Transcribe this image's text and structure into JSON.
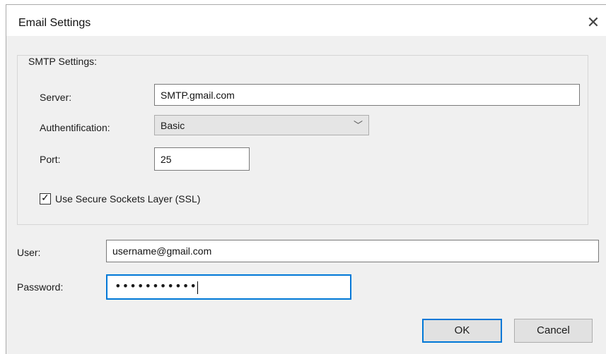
{
  "window": {
    "title": "Email Settings",
    "close_glyph": "✕"
  },
  "smtp": {
    "group_label": "SMTP Settings:",
    "server_label": "Server:",
    "server_value": "SMTP.gmail.com",
    "auth_label": "Authentification:",
    "auth_value": "Basic",
    "port_label": "Port:",
    "port_value": "25",
    "ssl_label": "Use Secure Sockets Layer (SSL)",
    "ssl_checked": true
  },
  "account": {
    "user_label": "User:",
    "user_value": "username@gmail.com",
    "password_label": "Password:",
    "password_masked": "•••••••••••"
  },
  "buttons": {
    "ok_label": "OK",
    "cancel_label": "Cancel"
  },
  "colors": {
    "focus_accent": "#0078d7",
    "window_bg": "#f0f0f0"
  }
}
